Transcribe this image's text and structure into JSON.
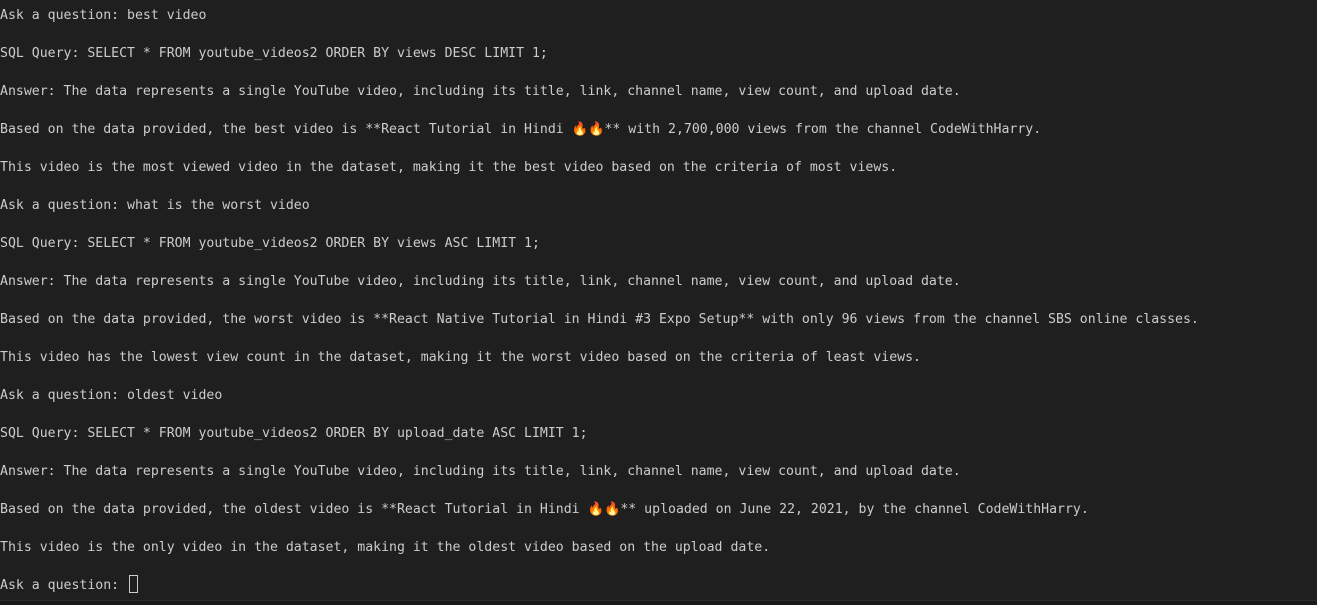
{
  "terminal": {
    "lines": [
      "Ask a question: best video",
      "SQL Query: SELECT * FROM youtube_videos2 ORDER BY views DESC LIMIT 1;",
      "Answer: The data represents a single YouTube video, including its title, link, channel name, view count, and upload date.",
      "Based on the data provided, the best video is **React Tutorial in Hindi 🔥🔥** with 2,700,000 views from the channel CodeWithHarry.",
      "This video is the most viewed video in the dataset, making it the best video based on the criteria of most views.",
      "Ask a question: what is the worst video",
      "SQL Query: SELECT * FROM youtube_videos2 ORDER BY views ASC LIMIT 1;",
      "Answer: The data represents a single YouTube video, including its title, link, channel name, view count, and upload date.",
      "Based on the data provided, the worst video is **React Native Tutorial in Hindi #3 Expo Setup** with only 96 views from the channel SBS online classes.",
      "This video has the lowest view count in the dataset, making it the worst video based on the criteria of least views.",
      "Ask a question: oldest video",
      "SQL Query: SELECT * FROM youtube_videos2 ORDER BY upload_date ASC LIMIT 1;",
      "Answer: The data represents a single YouTube video, including its title, link, channel name, view count, and upload date.",
      "Based on the data provided, the oldest video is **React Tutorial in Hindi 🔥🔥** uploaded on June 22, 2021, by the channel CodeWithHarry.",
      "This video is the only video in the dataset, making it the oldest video based on the upload date."
    ],
    "prompt": "Ask a question: ",
    "colors": {
      "background": "#1f1f1f",
      "text": "#cccccc"
    }
  }
}
